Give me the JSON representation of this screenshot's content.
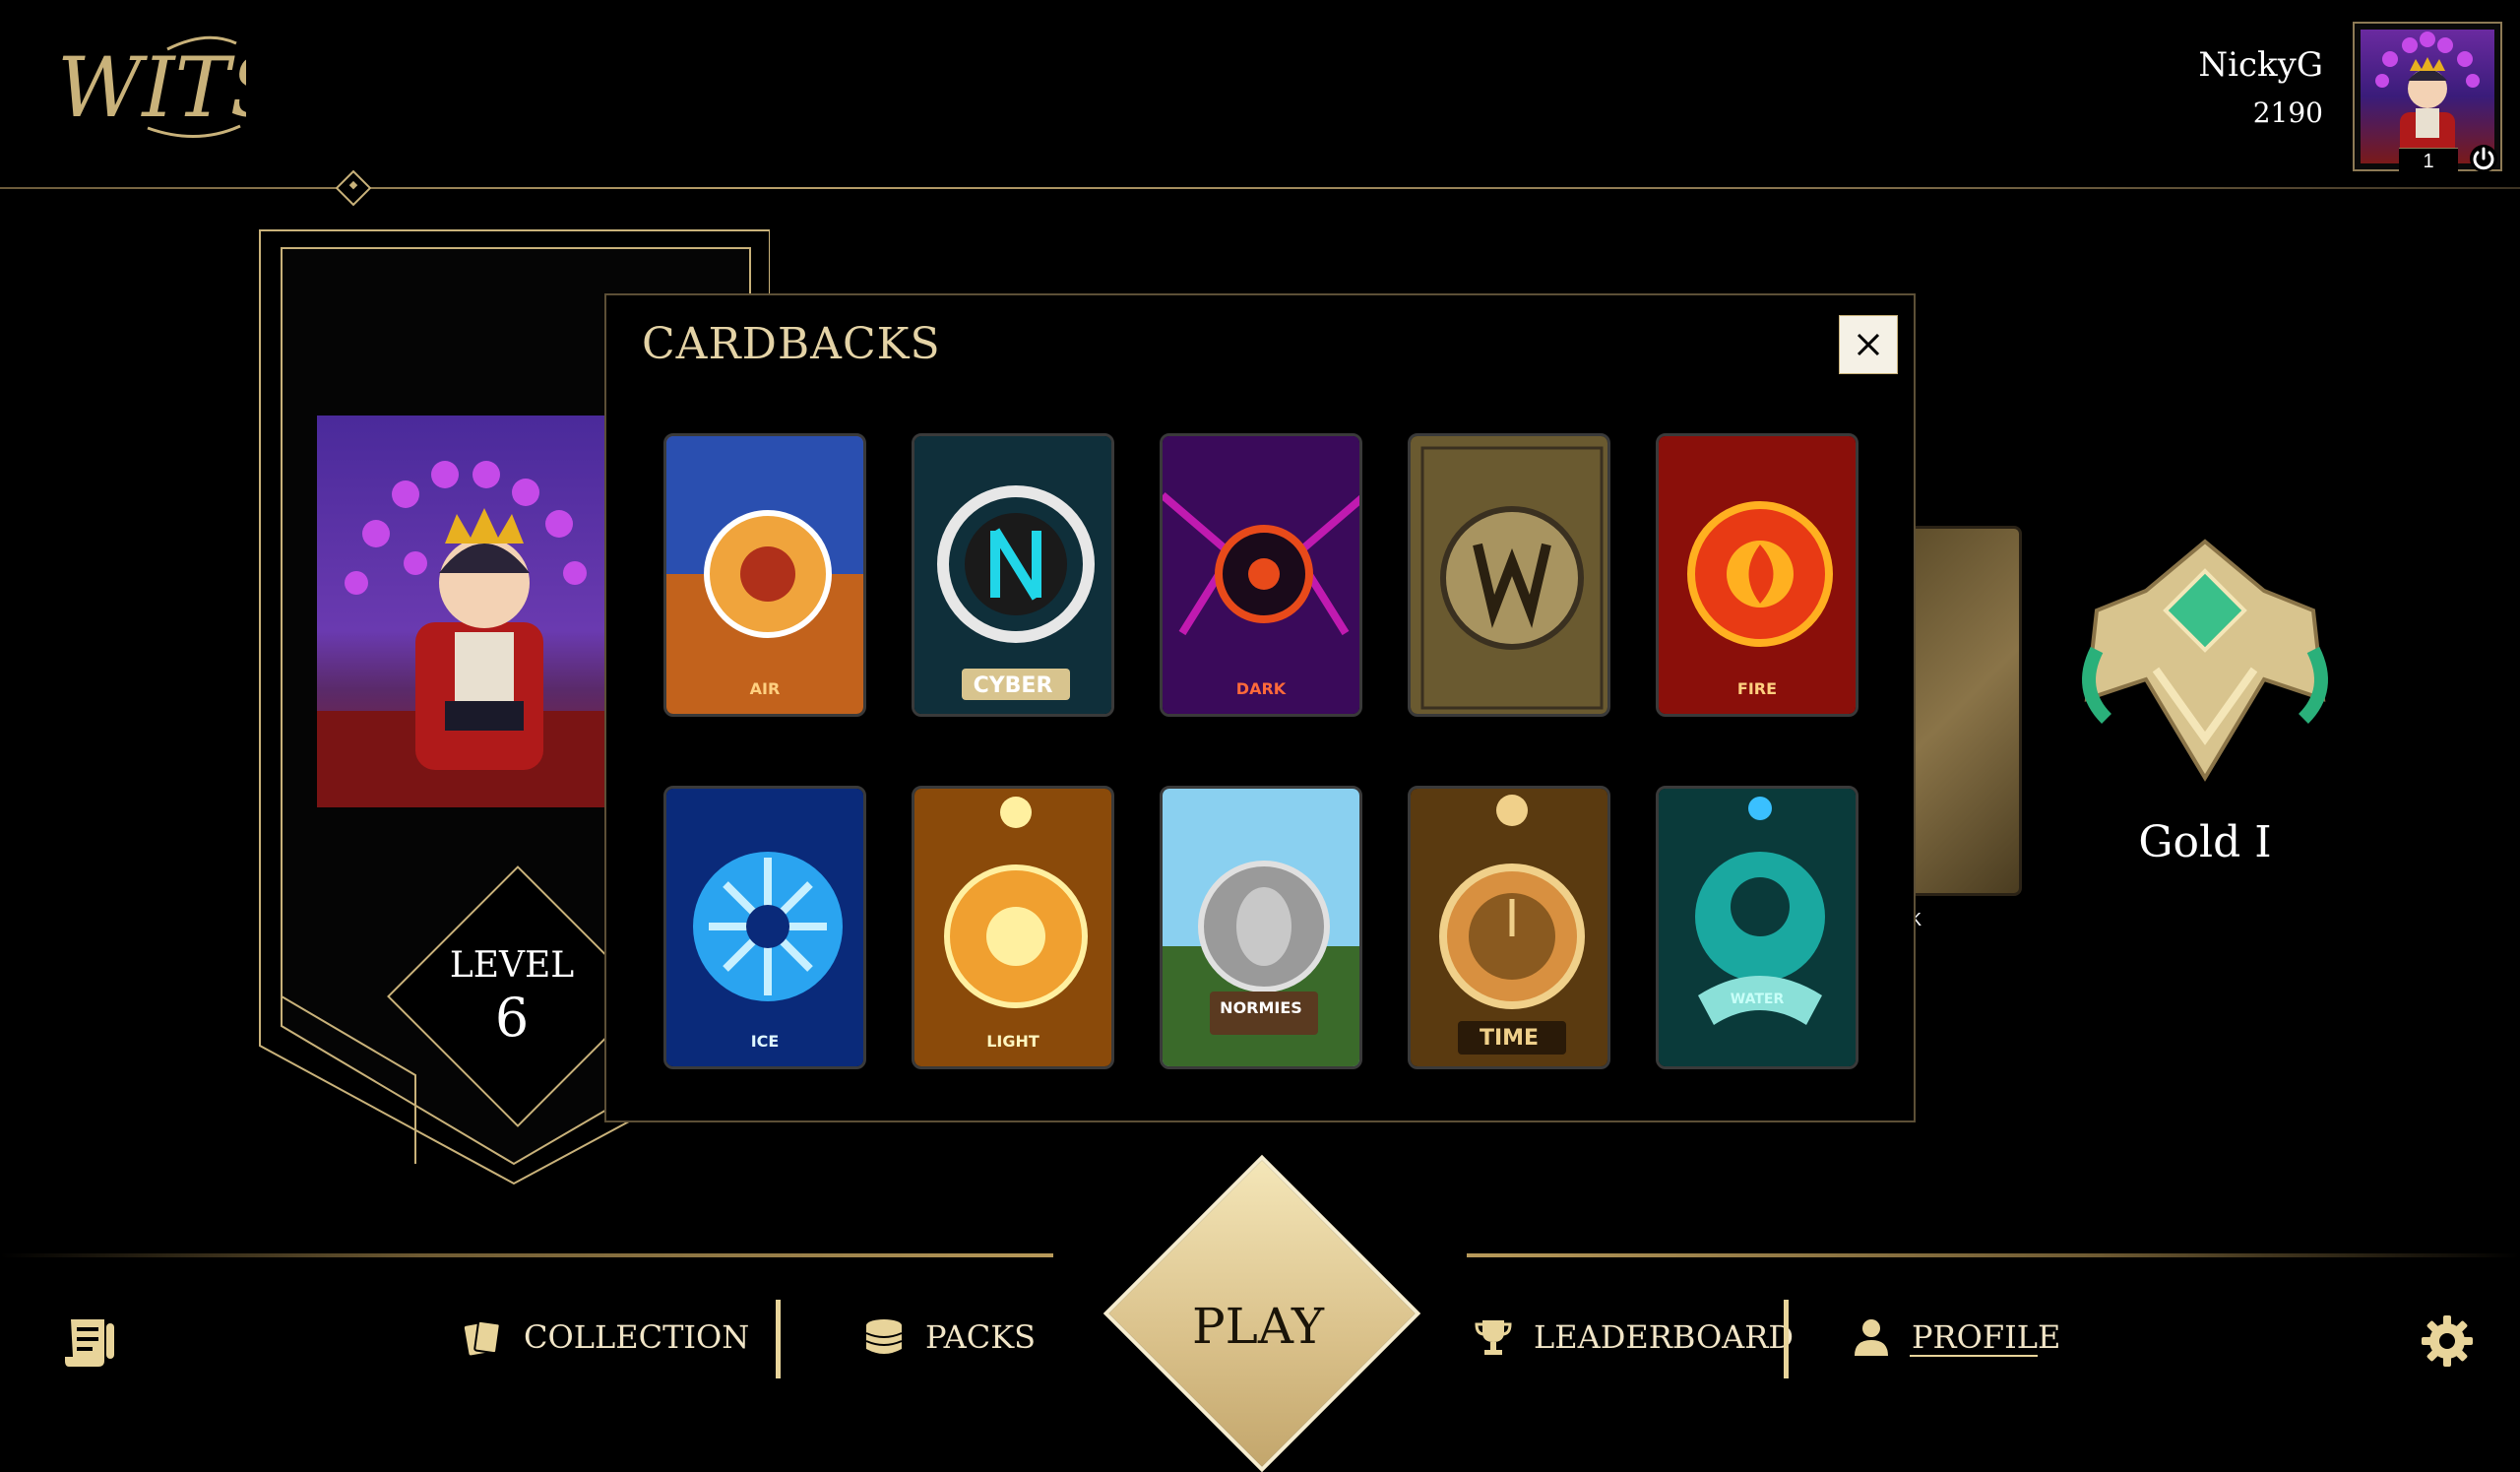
{
  "app": {
    "logo_text": "WITS"
  },
  "user": {
    "name": "NickyG",
    "rating": "2190",
    "avatar_level": "1"
  },
  "profile": {
    "level_label": "LEVEL",
    "level_value": "6"
  },
  "rank": {
    "name": "Gold I",
    "card_label": "K"
  },
  "modal": {
    "title": "CARDBACKS",
    "cardbacks": [
      {
        "name": "AIR",
        "colors": [
          "#f0a43c",
          "#2a4fb0",
          "#c2621c"
        ]
      },
      {
        "name": "CYBER",
        "colors": [
          "#0f2f3a",
          "#21d6e8",
          "#e7e7e7"
        ]
      },
      {
        "name": "DARK",
        "colors": [
          "#3a0a5a",
          "#c01ab0",
          "#e84a1a"
        ]
      },
      {
        "name": "W",
        "colors": [
          "#6a5a30",
          "#a89460",
          "#3a3020"
        ]
      },
      {
        "name": "FIRE",
        "colors": [
          "#8a0f0a",
          "#e83a14",
          "#ffb020"
        ]
      },
      {
        "name": "ICE",
        "colors": [
          "#0a2a7a",
          "#2aa4f0",
          "#c8f0ff"
        ]
      },
      {
        "name": "LIGHT",
        "colors": [
          "#8a4a0a",
          "#f0a030",
          "#fff0a0"
        ]
      },
      {
        "name": "NORMIES",
        "colors": [
          "#3a6a2a",
          "#8ad0f0",
          "#9a9a9a"
        ]
      },
      {
        "name": "TIME",
        "colors": [
          "#5a3a10",
          "#d89040",
          "#f0d08a"
        ]
      },
      {
        "name": "WATER",
        "colors": [
          "#0a3a3a",
          "#1aa8a0",
          "#8ae0d8"
        ]
      }
    ]
  },
  "nav": {
    "collection": "COLLECTION",
    "packs": "PACKS",
    "play": "PLAY",
    "leaderboard": "LEADERBOARD",
    "profile": "PROFILE"
  },
  "theme": {
    "gold": "#c9b27a",
    "gold_light": "#f4e6b8",
    "text": "#e4d3a6"
  }
}
